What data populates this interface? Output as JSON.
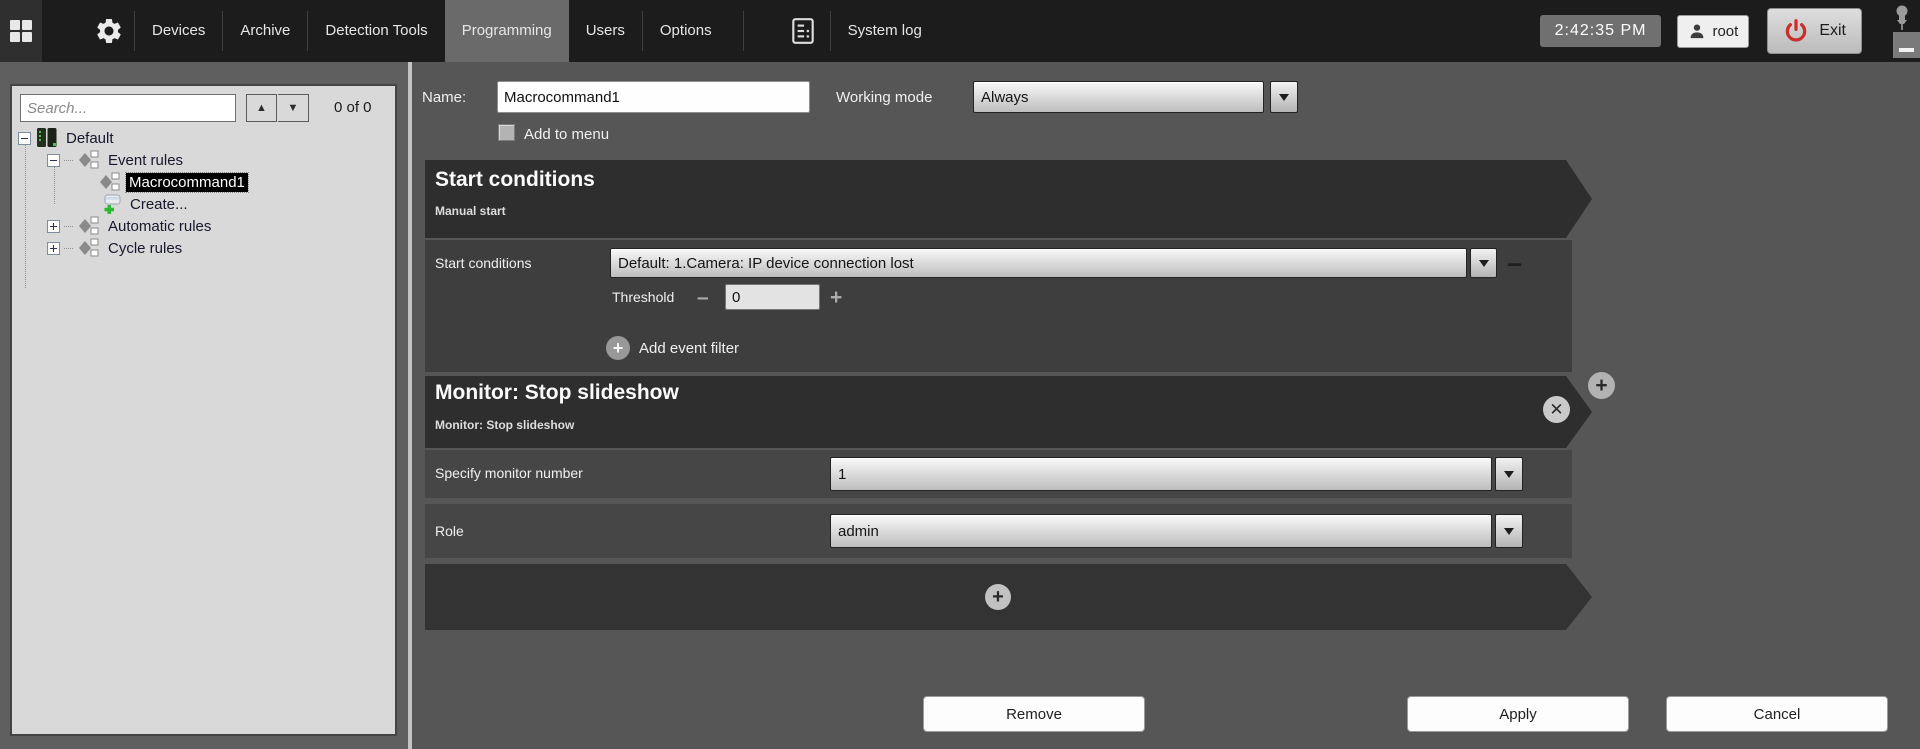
{
  "colors": {
    "topbar_bg": "#1c1c1c",
    "active_tab_bg": "#6a6a6a",
    "main_bg": "#565656",
    "section_header_bg": "#2e2e2e",
    "sidebar_panel_bg": "#d9d9d9",
    "selection_bg": "#000000",
    "exit_power_red": "#c9302c",
    "create_plus_green": "#2eb82e"
  },
  "topbar": {
    "tabs": [
      "Devices",
      "Archive",
      "Detection Tools",
      "Programming",
      "Users",
      "Options"
    ],
    "active_tab": "Programming",
    "system_log_label": "System log",
    "clock": "2:42:35 PM",
    "user_name": "root",
    "exit_label": "Exit"
  },
  "sidebar": {
    "search_placeholder": "Search...",
    "match_counter": "0 of 0",
    "tree": {
      "items": [
        {
          "label": "Default",
          "level": 0,
          "state": "expanded"
        },
        {
          "label": "Event rules",
          "level": 1,
          "state": "expanded"
        },
        {
          "label": "Macrocommand1",
          "level": 2,
          "state": "selected"
        },
        {
          "label": "Create...",
          "level": 2,
          "state": "create-action"
        },
        {
          "label": "Automatic rules",
          "level": 1,
          "state": "collapsed"
        },
        {
          "label": "Cycle rules",
          "level": 1,
          "state": "collapsed"
        }
      ]
    }
  },
  "form": {
    "name_label": "Name:",
    "name_value": "Macrocommand1",
    "working_mode_label": "Working mode",
    "working_mode_value": "Always",
    "add_to_menu_label": "Add to menu",
    "add_to_menu_checked": false
  },
  "start_section": {
    "title": "Start conditions",
    "subtitle": "Manual start",
    "condition_label": "Start conditions",
    "condition_value": "Default: 1.Camera: IP device connection lost",
    "threshold_label": "Threshold",
    "threshold_value": "0",
    "add_filter_label": "Add event filter"
  },
  "action_section": {
    "title": "Monitor: Stop slideshow",
    "subtitle": "Monitor: Stop slideshow",
    "rows": [
      {
        "label": "Specify monitor number",
        "value": "1"
      },
      {
        "label": "Role",
        "value": "admin"
      }
    ]
  },
  "footer": {
    "remove_label": "Remove",
    "apply_label": "Apply",
    "cancel_label": "Cancel"
  }
}
